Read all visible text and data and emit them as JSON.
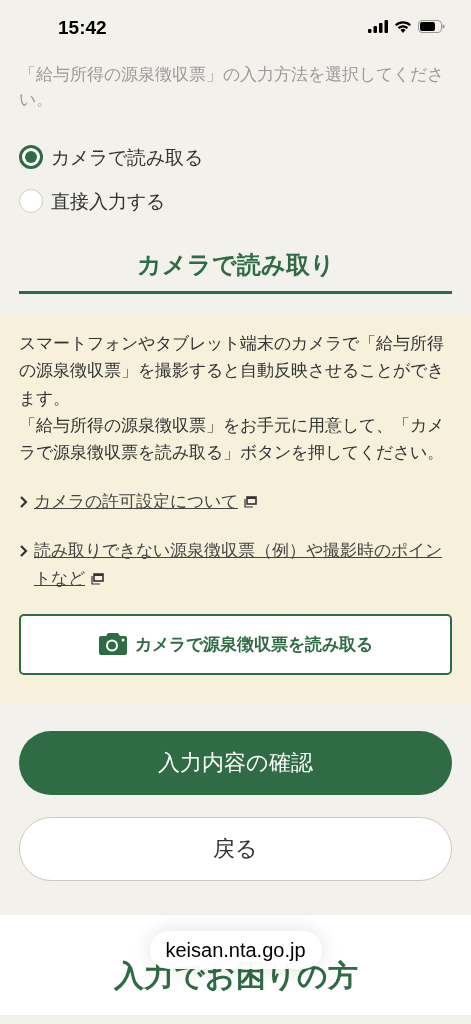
{
  "status_bar": {
    "time": "15:42"
  },
  "intro": "「給与所得の源泉徴収票」の入力方法を選択してください。",
  "options": [
    {
      "label": "カメラで読み取る",
      "selected": true
    },
    {
      "label": "直接入力する",
      "selected": false
    }
  ],
  "section": {
    "heading": "カメラで読み取り",
    "paragraphs": [
      "スマートフォンやタブレット端末のカメラで「給与所得の源泉徴収票」を撮影すると自動反映させることができます。",
      "「給与所得の源泉徴収票」をお手元に用意して、「カメラで源泉徴収票を読み取る」ボタンを押してください。"
    ],
    "links": [
      "カメラの許可設定について",
      "読み取りできない源泉徴収票（例）や撮影時のポイントなど"
    ],
    "camera_button": "カメラで源泉徴収票を読み取る"
  },
  "buttons": [
    {
      "label": "入力内容の確認",
      "kind": "primary"
    },
    {
      "label": "戻る",
      "kind": "secondary"
    }
  ],
  "footer": {
    "heading": "入力でお困りの方"
  },
  "url_bar": "keisan.nta.go.jp"
}
